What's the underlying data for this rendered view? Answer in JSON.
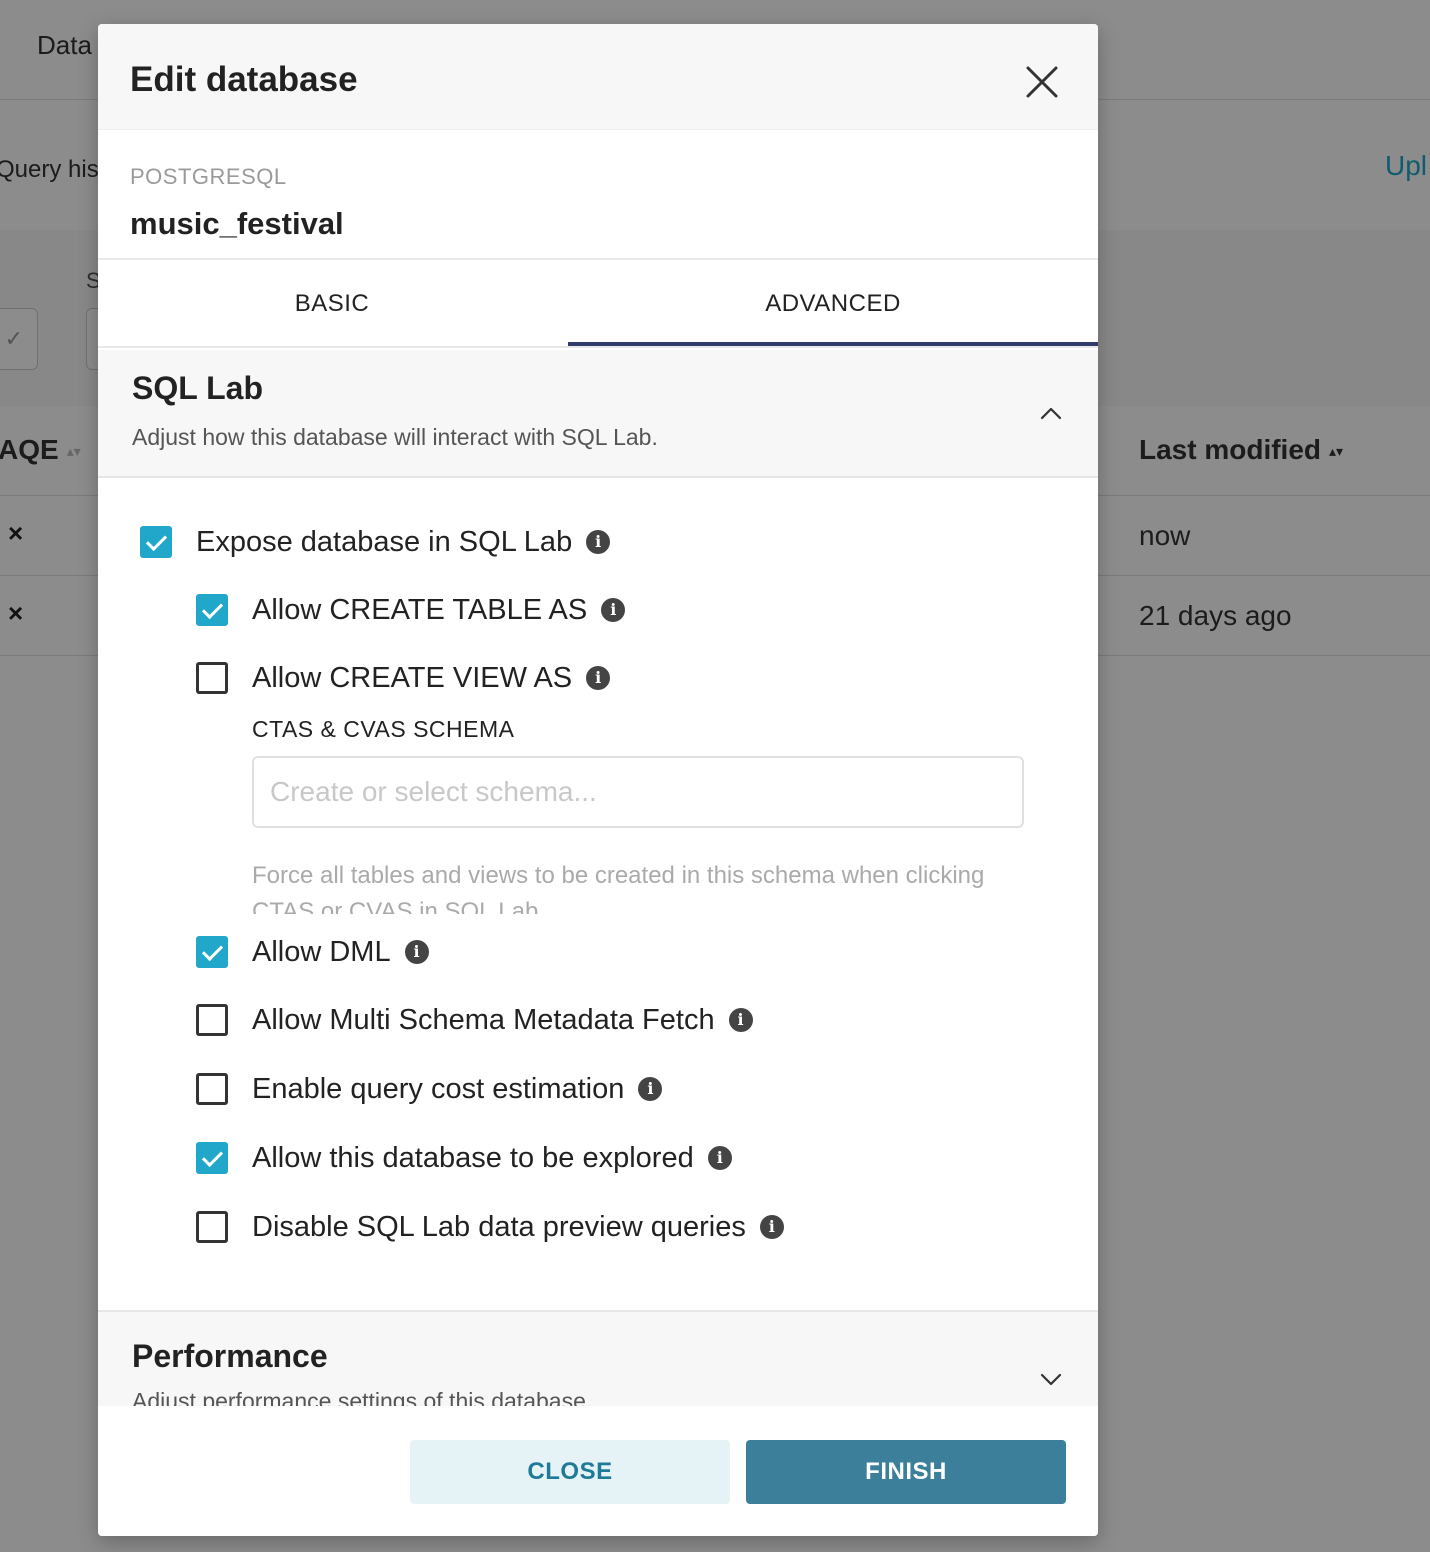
{
  "background": {
    "brand": "Data",
    "subnav_left": "Query hist",
    "subnav_right": "Upl",
    "filter_label": "S",
    "table": {
      "col_left": "AQE",
      "col_right": "Last modified",
      "rows": [
        {
          "aqe": "×",
          "modified": "now"
        },
        {
          "aqe": "×",
          "modified": "21 days ago"
        }
      ]
    }
  },
  "modal": {
    "title": "Edit database",
    "engine": "POSTGRESQL",
    "db_name": "music_festival",
    "tabs": [
      {
        "label": "BASIC",
        "active": false
      },
      {
        "label": "ADVANCED",
        "active": true
      }
    ],
    "sql_lab": {
      "title": "SQL Lab",
      "description": "Adjust how this database will interact with SQL Lab.",
      "expanded": true,
      "options": [
        {
          "label": "Expose database in SQL Lab",
          "checked": true
        },
        {
          "label": "Allow CREATE TABLE AS",
          "checked": true
        },
        {
          "label": "Allow CREATE VIEW AS",
          "checked": false
        },
        {
          "label": "Allow DML",
          "checked": true
        },
        {
          "label": "Allow Multi Schema Metadata Fetch",
          "checked": false
        },
        {
          "label": "Enable query cost estimation",
          "checked": false
        },
        {
          "label": "Allow this database to be explored",
          "checked": true
        },
        {
          "label": "Disable SQL Lab data preview queries",
          "checked": false
        }
      ],
      "schema_label": "CTAS & CVAS SCHEMA",
      "schema_placeholder": "Create or select schema...",
      "schema_value": "",
      "schema_help": "Force all tables and views to be created in this schema when clicking CTAS or CVAS in SQL Lab."
    },
    "performance": {
      "title": "Performance",
      "description": "Adjust performance settings of this database.",
      "expanded": false
    },
    "footer": {
      "close_label": "CLOSE",
      "finish_label": "FINISH"
    }
  },
  "colors": {
    "accent": "#20a7c9",
    "tab_ink": "#323c6a",
    "finish_button": "#3c7f9b",
    "close_button_bg": "#e6f3f6"
  },
  "icons": {
    "close": "close-icon",
    "info": "info-icon",
    "chevron_up": "chevron-up-icon",
    "chevron_down": "chevron-down-icon",
    "check": "checkmark-icon"
  }
}
